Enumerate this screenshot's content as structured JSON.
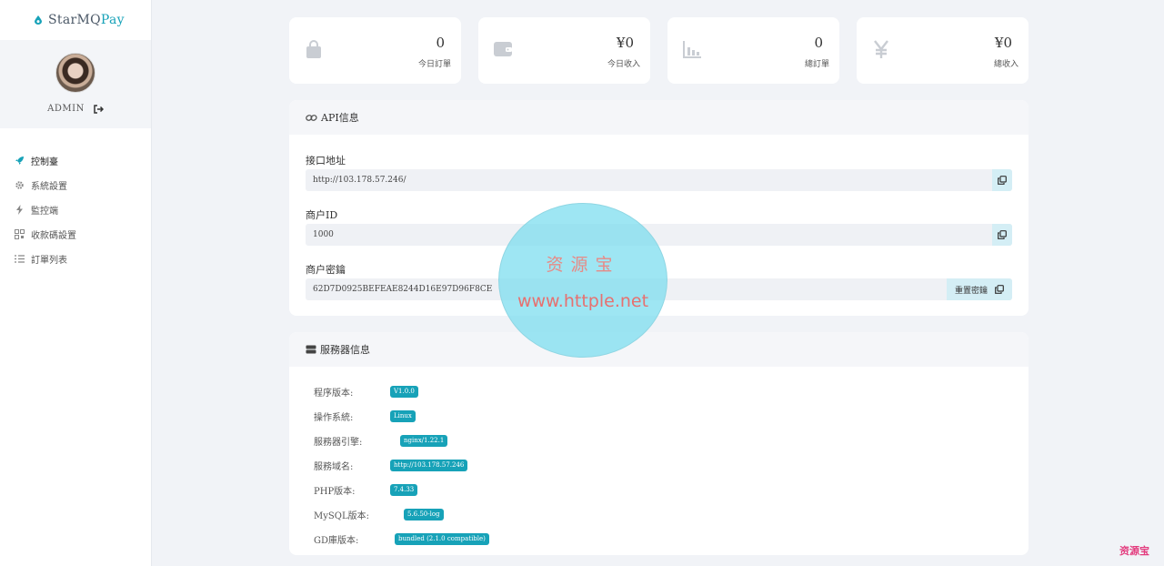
{
  "brand": {
    "name_prefix": "StarMQ",
    "name_accent": "Pay"
  },
  "user": {
    "name": "ADMIN"
  },
  "nav": [
    {
      "label": "控制臺",
      "icon": "rocket-icon",
      "active": true
    },
    {
      "label": "系統設置",
      "icon": "gear-icon",
      "active": false
    },
    {
      "label": "監控端",
      "icon": "bolt-icon",
      "active": false
    },
    {
      "label": "收款碼設置",
      "icon": "qrcode-icon",
      "active": false
    },
    {
      "label": "訂單列表",
      "icon": "list-icon",
      "active": false
    }
  ],
  "stats": [
    {
      "value": "0",
      "label": "今日訂單",
      "icon": "bag-icon"
    },
    {
      "value": "¥0",
      "label": "今日收入",
      "icon": "wallet-icon"
    },
    {
      "value": "0",
      "label": "總訂單",
      "icon": "bar-chart-icon"
    },
    {
      "value": "¥0",
      "label": "總收入",
      "icon": "yen-icon"
    }
  ],
  "api": {
    "title": "API信息",
    "endpoint_label": "接口地址",
    "endpoint_value": "http://103.178.57.246/",
    "merchant_id_label": "商户ID",
    "merchant_id_value": "1000",
    "key_label": "商户密鑰",
    "key_value": "62D7D0925BEFEAE8244D16E97D96F8CE",
    "reset_label": "重置密鑰"
  },
  "server": {
    "title": "服務器信息",
    "rows": [
      {
        "label": "程序版本:",
        "value": "V1.0.0"
      },
      {
        "label": "操作系統:",
        "value": "Linux"
      },
      {
        "label": "服務器引擎:",
        "value": "nginx/1.22.1"
      },
      {
        "label": "服務域名:",
        "value": "http://103.178.57.246"
      },
      {
        "label": "PHP版本:",
        "value": "7.4.33"
      },
      {
        "label": "MySQL版本:",
        "value": "5.6.50-log"
      },
      {
        "label": "GD庫版本:",
        "value": "bundled (2.1.0 compatible)"
      }
    ]
  },
  "watermark": {
    "line1": "资源宝",
    "line2": "www.httple.net",
    "corner": "资源宝"
  },
  "colors": {
    "accent": "#17a2b8",
    "background": "#f1f3f7"
  }
}
